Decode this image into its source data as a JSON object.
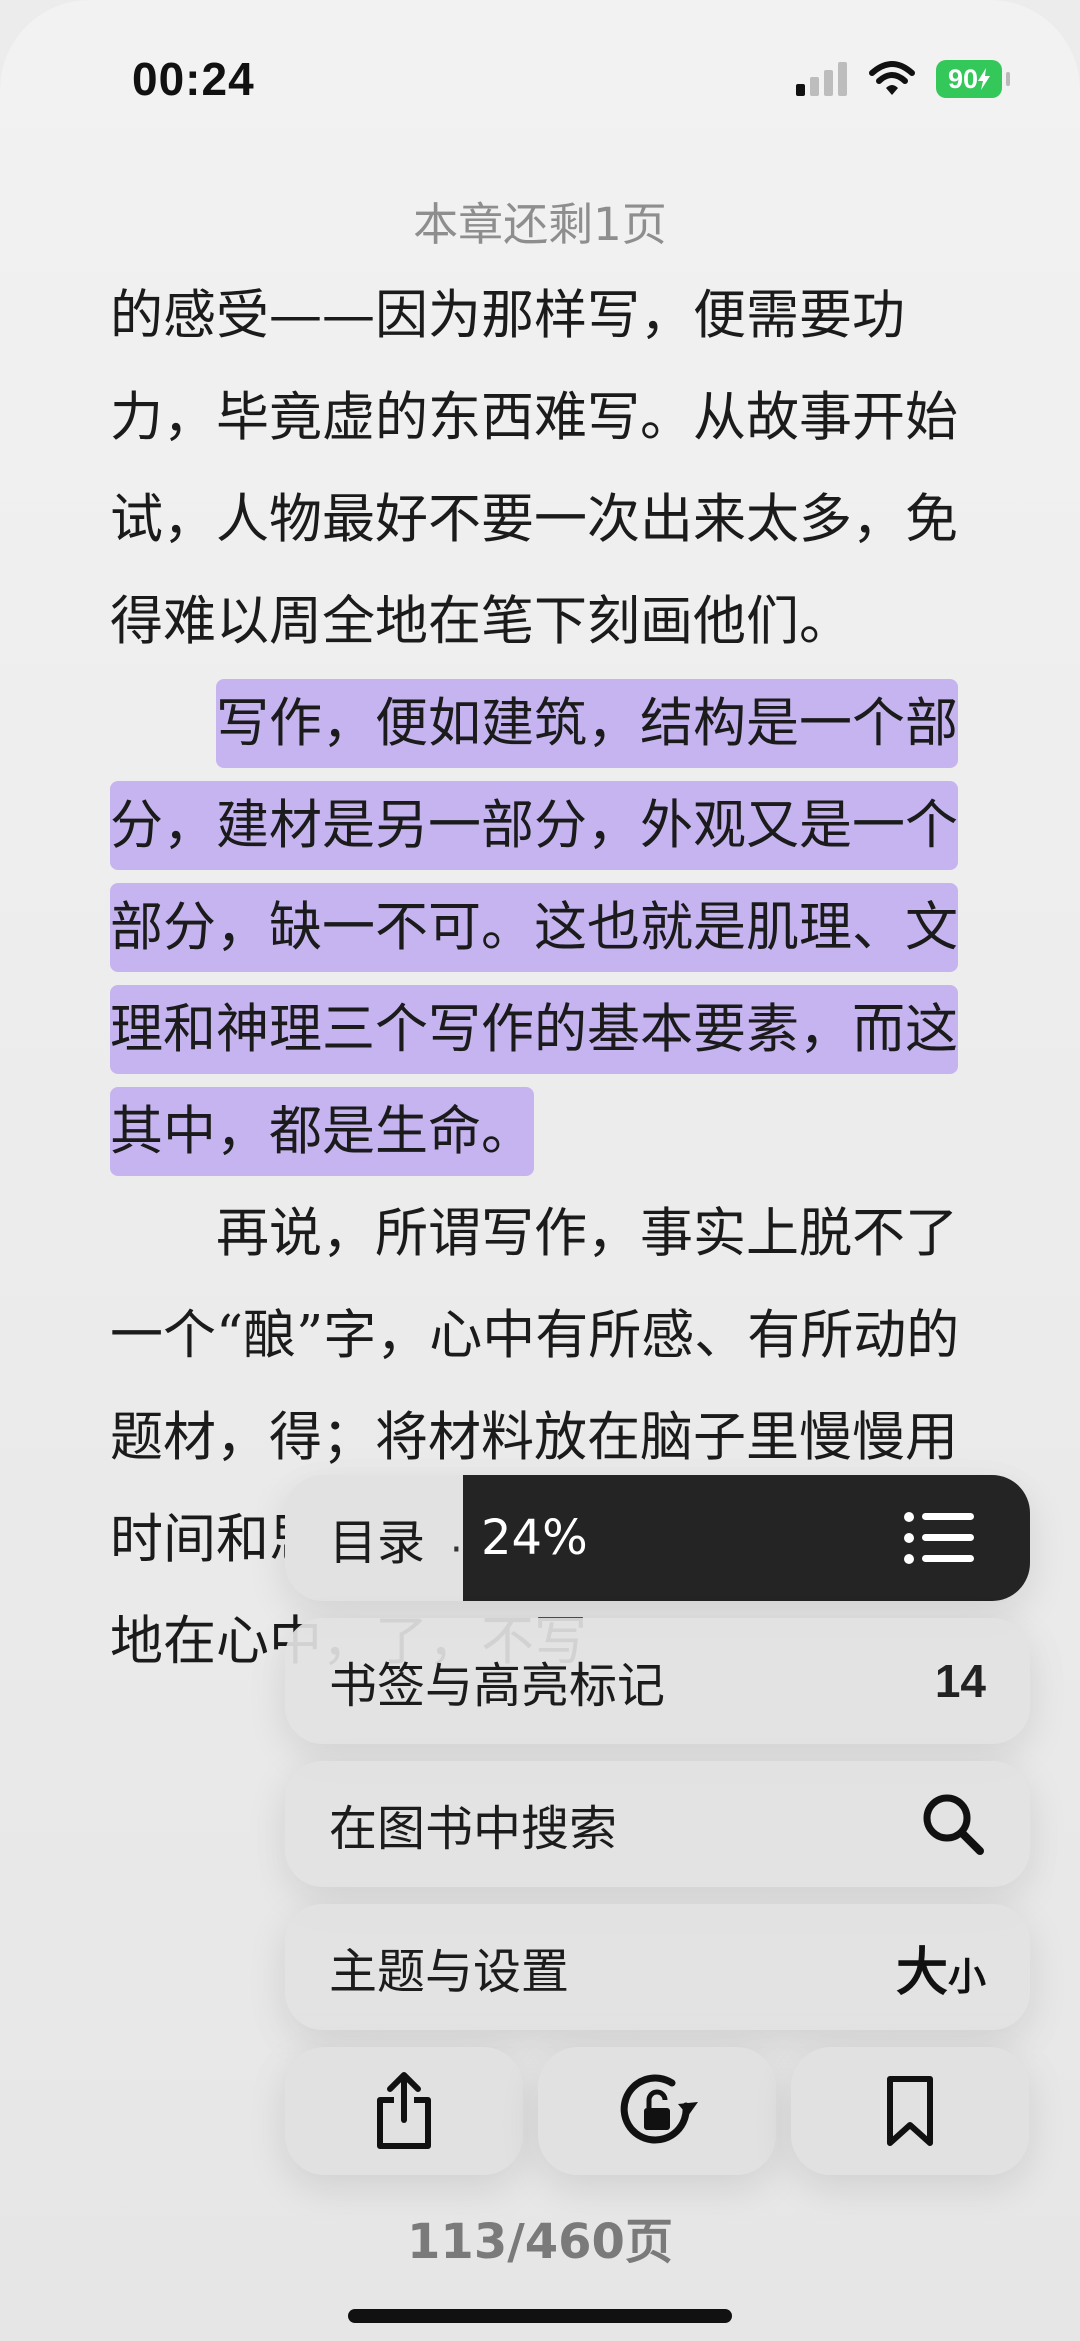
{
  "status_bar": {
    "time": "00:24",
    "battery": "90"
  },
  "reader": {
    "chapter_remaining": "本章还剩1页",
    "paragraph_1": "的感受——因为那样写，便需要功力，毕竟虚的东西难写。从故事开始试，人物最好不要一次出来太多，免得难以周全地在笔下刻画他们。",
    "highlighted_paragraph": "写作，便如建筑，结构是一个部分，建材是另一部分，外观又是一个部分，缺一不可。这也就是肌理、文理和神理三个写作的基本要素，而这其中，都是生命。",
    "paragraph_3": "再说，所谓写作，事实上脱不了一个“酿”字，心中有所感、有所动的题材，得；将材料放在脑子里慢慢用时间和思想去酝酿它，自己反反复复地在心中，了，不写",
    "highlight_color": "#c6b4f0"
  },
  "menu": {
    "toc_label": "目录",
    "toc_progress": "24%",
    "bookmarks_label": "书签与高亮标记",
    "bookmarks_count": "14",
    "search_label": "在图书中搜索",
    "theme_label": "主题与设置",
    "size_big": "大",
    "size_small": "小"
  },
  "actions": [
    "share-icon",
    "rotation-lock-icon",
    "bookmark-icon"
  ],
  "footer": {
    "page_indicator": "113/460页"
  }
}
